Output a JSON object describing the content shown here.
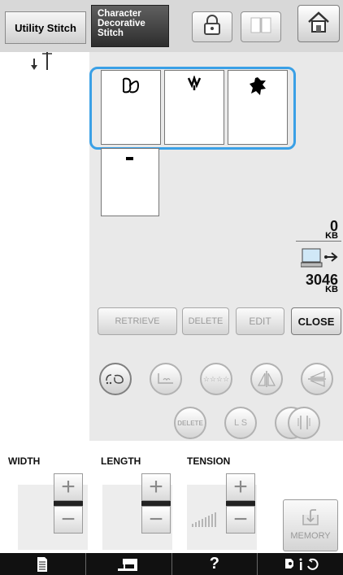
{
  "tabs": {
    "utility_label": "Utility Stitch",
    "character_label_lines": [
      "Character",
      "Decorative",
      "Stitch"
    ]
  },
  "memory": {
    "machine_used": "0",
    "machine_unit": "KB",
    "usb_free": "3046",
    "usb_unit": "KB"
  },
  "actions": {
    "retrieve": "RETRIEVE",
    "delete": "DELETE",
    "edit": "EDIT",
    "close": "CLOSE"
  },
  "edit_buttons": {
    "delete": "DELETE",
    "ls": "L  S"
  },
  "controls": {
    "width_label": "WIDTH",
    "length_label": "LENGTH",
    "tension_label": "TENSION",
    "plus": "+",
    "minus": "−",
    "memory_label": "MEMORY"
  },
  "bottombar": {
    "help": "?"
  },
  "icons": {
    "lock": "lock-icon",
    "book": "book-icon",
    "home": "home-icon",
    "needle": "needle-position-icon",
    "usb": "usb-computer-icon"
  },
  "colors": {
    "selection": "#3aa0e6",
    "topbar": "#d8d8d8",
    "panel": "#e9e9e9"
  }
}
